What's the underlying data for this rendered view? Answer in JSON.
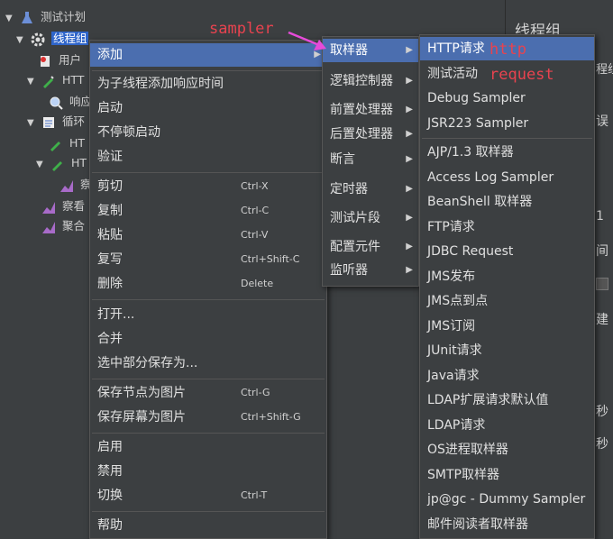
{
  "tree": {
    "items": [
      {
        "label": "测试计划",
        "icon": "flask-icon"
      },
      {
        "label": "线程组",
        "icon": "gear-icon"
      },
      {
        "label": "用户",
        "icon": "user-defined-variables-icon"
      },
      {
        "label": "HTT",
        "icon": "pipette-icon"
      },
      {
        "label": "响应",
        "icon": "magnifier-icon"
      },
      {
        "label": "循环",
        "icon": "loop-controller-icon"
      },
      {
        "label": "HT",
        "icon": "pipette-icon"
      },
      {
        "label": "HT",
        "icon": "pipette-icon"
      },
      {
        "label": "察",
        "icon": "listener-graph-icon"
      },
      {
        "label": "察看",
        "icon": "listener-graph-icon"
      },
      {
        "label": "聚合",
        "icon": "listener-graph-icon"
      }
    ]
  },
  "right_pane": {
    "title": "线程组",
    "frag1": "程组",
    "frag2": "误",
    "frag3": "1",
    "frag4": "间",
    "frag5": "建",
    "frag6": "秒",
    "frag7": "秒"
  },
  "context_menu": {
    "add": "添加",
    "add_think_time": "为子线程添加响应时间",
    "start": "启动",
    "start_no_pause": "不停顿启动",
    "validate": "验证",
    "cut": "剪切",
    "cut_sc": "Ctrl-X",
    "copy": "复制",
    "copy_sc": "Ctrl-C",
    "paste": "粘贴",
    "paste_sc": "Ctrl-V",
    "duplicate": "复写",
    "duplicate_sc": "Ctrl+Shift-C",
    "remove": "删除",
    "remove_sc": "Delete",
    "open": "打开...",
    "merge": "合并",
    "save_selection": "选中部分保存为...",
    "save_node_image": "保存节点为图片",
    "save_node_image_sc": "Ctrl-G",
    "save_screen_image": "保存屏幕为图片",
    "save_screen_image_sc": "Ctrl+Shift-G",
    "enable": "启用",
    "disable": "禁用",
    "toggle": "切换",
    "toggle_sc": "Ctrl-T",
    "help": "帮助"
  },
  "add_menu": [
    "取样器",
    "逻辑控制器",
    "前置处理器",
    "后置处理器",
    "断言",
    "定时器",
    "测试片段",
    "配置元件",
    "监听器"
  ],
  "sampler_menu": [
    "HTTP请求",
    "测试活动",
    "Debug Sampler",
    "JSR223 Sampler",
    "AJP/1.3 取样器",
    "Access Log Sampler",
    "BeanShell 取样器",
    "FTP请求",
    "JDBC Request",
    "JMS发布",
    "JMS点到点",
    "JMS订阅",
    "JUnit请求",
    "Java请求",
    "LDAP扩展请求默认值",
    "LDAP请求",
    "OS进程取样器",
    "SMTP取样器",
    "jp@gc - Dummy Sampler",
    "邮件阅读者取样器"
  ],
  "annotations": {
    "sampler": "sampler",
    "http": "http",
    "request": "request"
  },
  "colors": {
    "background": "#3c3f41",
    "menu_highlight": "#4b6eaf",
    "tree_selection": "#2f65ca",
    "annotation": "#e8434f",
    "arrow": "#e64bd9"
  }
}
